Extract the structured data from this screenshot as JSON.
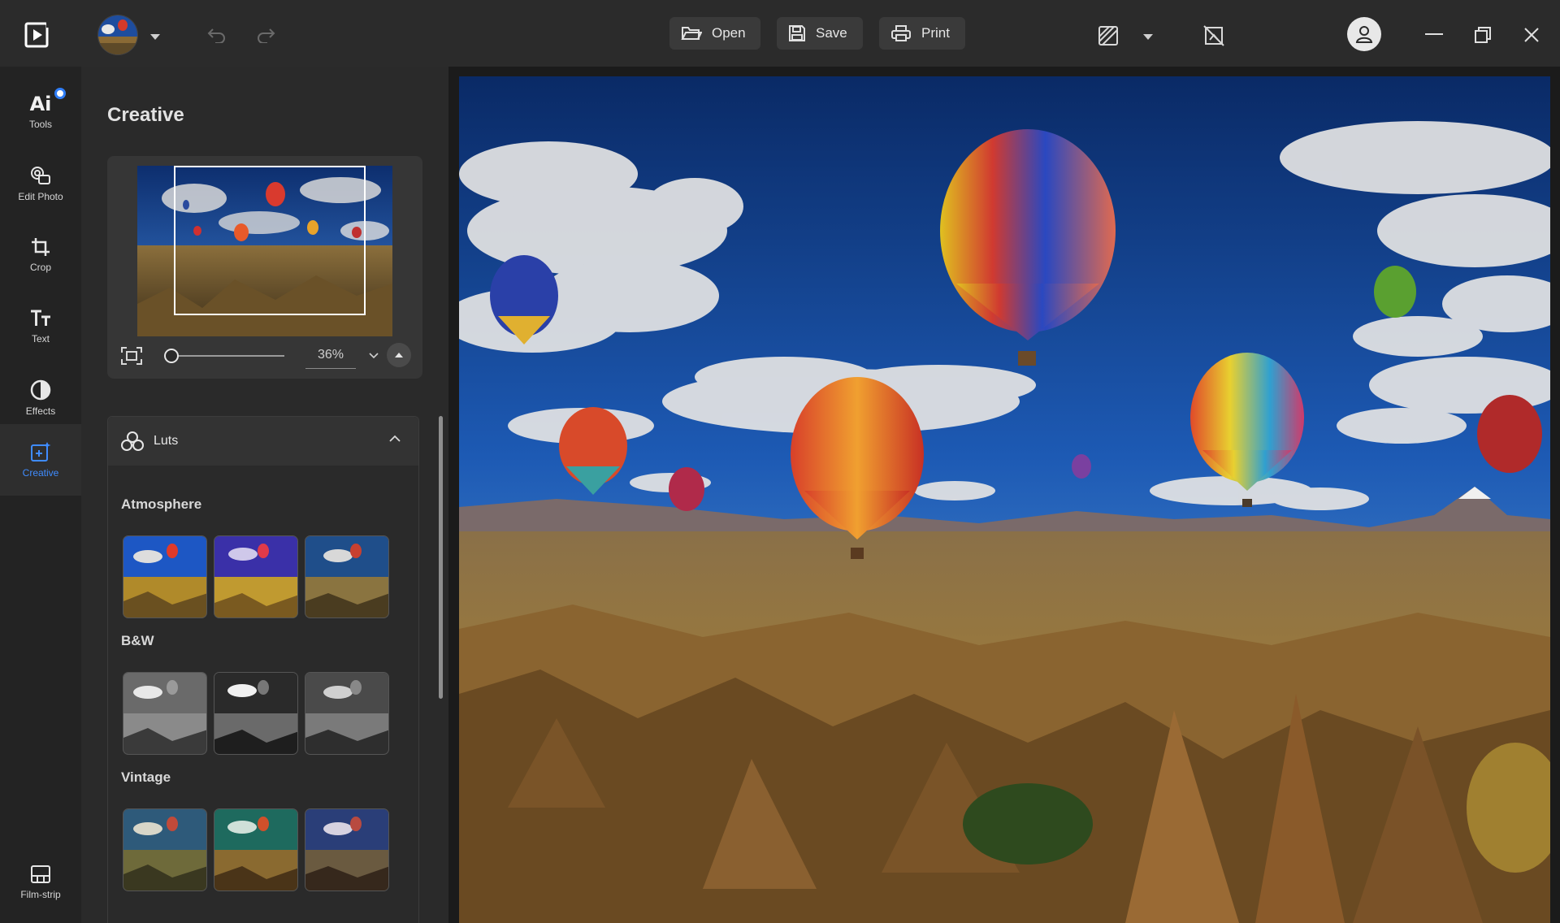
{
  "app": {
    "logo_icon": "app-play-logo-icon"
  },
  "toolbar": {
    "open_label": "Open",
    "save_label": "Save",
    "print_label": "Print"
  },
  "rail": {
    "items": [
      {
        "label": "Tools",
        "icon": "ai-icon"
      },
      {
        "label": "Edit Photo",
        "icon": "edit-photo-icon"
      },
      {
        "label": "Crop",
        "icon": "crop-icon"
      },
      {
        "label": "Text",
        "icon": "text-icon"
      },
      {
        "label": "Effects",
        "icon": "effects-icon"
      },
      {
        "label": "Creative",
        "icon": "creative-icon",
        "active": true
      },
      {
        "label": "Film-strip",
        "icon": "film-strip-icon"
      }
    ],
    "ai_glyph": "Ai"
  },
  "panel": {
    "title": "Creative",
    "zoom": {
      "value": "36%",
      "level_fraction": 0.0
    },
    "luts": {
      "title": "Luts",
      "sections": [
        {
          "name": "Atmosphere",
          "presets": 3
        },
        {
          "name": "B&W",
          "presets": 3
        },
        {
          "name": "Vintage",
          "presets": 3
        }
      ]
    }
  },
  "colors": {
    "accent": "#3f8cff",
    "topbar_bg": "#2b2b2b",
    "panel_bg": "#2a2a2a",
    "rail_bg": "#232323"
  }
}
